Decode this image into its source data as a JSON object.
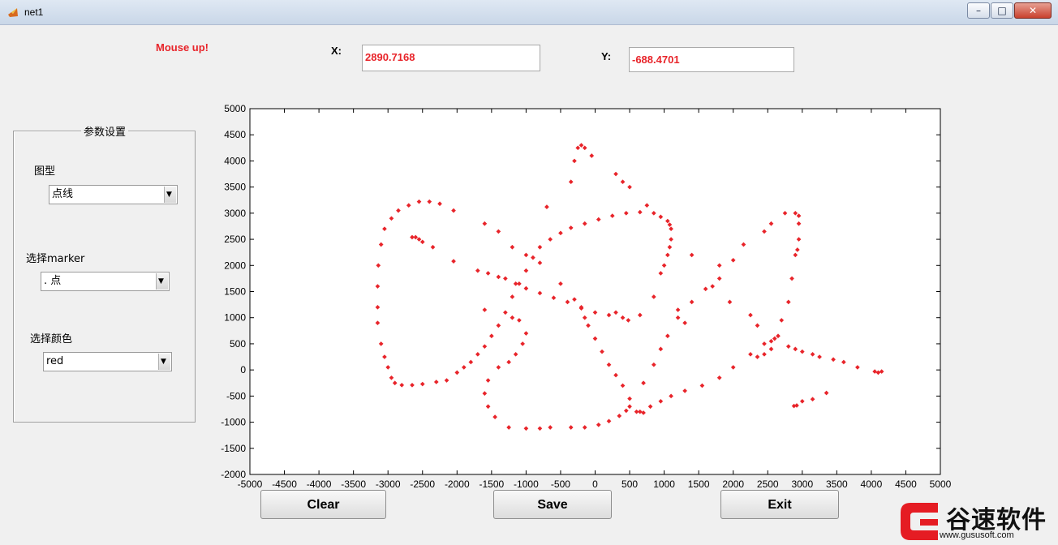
{
  "window": {
    "title": "net1"
  },
  "status": {
    "mouse": "Mouse up!"
  },
  "coords": {
    "x_label": "X:",
    "x_value": "2890.7168",
    "y_label": "Y:",
    "y_value": "-688.4701"
  },
  "panel": {
    "title": "参数设置",
    "plot_type": {
      "label": "图型",
      "value": "点线"
    },
    "marker": {
      "label": "选择marker",
      "value": ". 点"
    },
    "color": {
      "label": "选择颜色",
      "value": "red"
    }
  },
  "buttons": {
    "clear": "Clear",
    "save": "Save",
    "exit": "Exit"
  },
  "watermark": {
    "brand": "谷速软件",
    "url": "www.gususoft.com"
  },
  "colors": {
    "accent": "#e8242a",
    "marker": "#e8242a"
  },
  "chart_data": {
    "type": "scatter",
    "xlim": [
      -5000,
      5000
    ],
    "ylim": [
      -2000,
      5000
    ],
    "xticks": [
      "-5000",
      "-4500",
      "-4000",
      "-3500",
      "-3000",
      "-2500",
      "-2000",
      "-1500",
      "-1000",
      "-500",
      "0",
      "500",
      "1000",
      "1500",
      "2000",
      "2500",
      "3000",
      "3500",
      "4000",
      "4500",
      "5000"
    ],
    "yticks": [
      "-2000",
      "-1500",
      "-1000",
      "-500",
      "0",
      "500",
      "1000",
      "1500",
      "2000",
      "2500",
      "3000",
      "3500",
      "4000",
      "4500",
      "5000"
    ],
    "series": [
      {
        "color": "#e8242a",
        "points": [
          [
            -3150,
            900
          ],
          [
            -3150,
            1200
          ],
          [
            -3150,
            1600
          ],
          [
            -3140,
            2000
          ],
          [
            -3100,
            2400
          ],
          [
            -3050,
            2700
          ],
          [
            -2950,
            2900
          ],
          [
            -2850,
            3050
          ],
          [
            -2700,
            3150
          ],
          [
            -2550,
            3220
          ],
          [
            -2400,
            3220
          ],
          [
            -2250,
            3180
          ],
          [
            -2050,
            3050
          ],
          [
            -3100,
            500
          ],
          [
            -3050,
            250
          ],
          [
            -3000,
            50
          ],
          [
            -2950,
            -150
          ],
          [
            -2900,
            -250
          ],
          [
            -2800,
            -290
          ],
          [
            -2650,
            -290
          ],
          [
            -2500,
            -270
          ],
          [
            -2300,
            -230
          ],
          [
            -2150,
            -200
          ],
          [
            -2000,
            -50
          ],
          [
            -1900,
            50
          ],
          [
            -1800,
            150
          ],
          [
            -1700,
            300
          ],
          [
            -1600,
            450
          ],
          [
            -1500,
            650
          ],
          [
            -1400,
            850
          ],
          [
            -1300,
            1100
          ],
          [
            -1200,
            1400
          ],
          [
            -1100,
            1650
          ],
          [
            -1000,
            1900
          ],
          [
            -900,
            2150
          ],
          [
            -800,
            2350
          ],
          [
            -650,
            2500
          ],
          [
            -500,
            2620
          ],
          [
            -350,
            2720
          ],
          [
            -150,
            2800
          ],
          [
            50,
            2880
          ],
          [
            250,
            2950
          ],
          [
            450,
            3000
          ],
          [
            650,
            3020
          ],
          [
            850,
            3000
          ],
          [
            950,
            2930
          ],
          [
            1050,
            2850
          ],
          [
            1080,
            2780
          ],
          [
            1100,
            2700
          ],
          [
            1100,
            2500
          ],
          [
            1080,
            2350
          ],
          [
            1050,
            2200
          ],
          [
            1000,
            2000
          ],
          [
            950,
            1850
          ],
          [
            -2650,
            2540
          ],
          [
            -2600,
            2540
          ],
          [
            -2550,
            2500
          ],
          [
            -2500,
            2450
          ],
          [
            -2350,
            2350
          ],
          [
            -2050,
            2080
          ],
          [
            -1700,
            1900
          ],
          [
            -1550,
            1850
          ],
          [
            -1400,
            1780
          ],
          [
            -1300,
            1750
          ],
          [
            -1150,
            1650
          ],
          [
            -1000,
            1560
          ],
          [
            -800,
            1470
          ],
          [
            -600,
            1380
          ],
          [
            -400,
            1300
          ],
          [
            -200,
            1180
          ],
          [
            0,
            1100
          ],
          [
            200,
            1050
          ],
          [
            400,
            1000
          ],
          [
            480,
            950
          ],
          [
            -700,
            3120
          ],
          [
            -350,
            3600
          ],
          [
            -300,
            4000
          ],
          [
            -250,
            4250
          ],
          [
            -200,
            4300
          ],
          [
            -150,
            4250
          ],
          [
            -50,
            4100
          ],
          [
            300,
            3750
          ],
          [
            400,
            3600
          ],
          [
            500,
            3500
          ],
          [
            750,
            3150
          ],
          [
            -1600,
            2800
          ],
          [
            -1400,
            2650
          ],
          [
            -1200,
            2350
          ],
          [
            -1000,
            2200
          ],
          [
            -800,
            2050
          ],
          [
            -1600,
            1150
          ],
          [
            -1200,
            1000
          ],
          [
            -1100,
            950
          ],
          [
            -1000,
            700
          ],
          [
            -1050,
            500
          ],
          [
            -1150,
            300
          ],
          [
            -1250,
            150
          ],
          [
            -1400,
            50
          ],
          [
            -1550,
            -200
          ],
          [
            -1600,
            -450
          ],
          [
            -1550,
            -700
          ],
          [
            -1450,
            -900
          ],
          [
            -1250,
            -1100
          ],
          [
            -1000,
            -1120
          ],
          [
            -800,
            -1120
          ],
          [
            -650,
            -1100
          ],
          [
            -350,
            -1100
          ],
          [
            -150,
            -1100
          ],
          [
            50,
            -1050
          ],
          [
            200,
            -980
          ],
          [
            350,
            -880
          ],
          [
            450,
            -780
          ],
          [
            500,
            -700
          ],
          [
            -500,
            1650
          ],
          [
            -300,
            1350
          ],
          [
            -200,
            1200
          ],
          [
            -150,
            1000
          ],
          [
            -100,
            850
          ],
          [
            0,
            600
          ],
          [
            100,
            350
          ],
          [
            200,
            100
          ],
          [
            300,
            -100
          ],
          [
            400,
            -300
          ],
          [
            500,
            -550
          ],
          [
            600,
            -800
          ],
          [
            650,
            -800
          ],
          [
            700,
            -820
          ],
          [
            800,
            -700
          ],
          [
            950,
            -600
          ],
          [
            1100,
            -500
          ],
          [
            1300,
            -400
          ],
          [
            1550,
            -300
          ],
          [
            1800,
            -150
          ],
          [
            2000,
            50
          ],
          [
            2250,
            300
          ],
          [
            2450,
            500
          ],
          [
            2550,
            550
          ],
          [
            2650,
            650
          ],
          [
            700,
            -250
          ],
          [
            850,
            100
          ],
          [
            950,
            400
          ],
          [
            1050,
            650
          ],
          [
            1200,
            1000
          ],
          [
            1400,
            1300
          ],
          [
            1600,
            1550
          ],
          [
            1800,
            1750
          ],
          [
            2000,
            2100
          ],
          [
            2150,
            2400
          ],
          [
            2450,
            2650
          ],
          [
            2550,
            2800
          ],
          [
            2750,
            3000
          ],
          [
            2900,
            3000
          ],
          [
            2950,
            2950
          ],
          [
            2950,
            2800
          ],
          [
            2950,
            2500
          ],
          [
            2930,
            2300
          ],
          [
            2900,
            2200
          ],
          [
            2850,
            1750
          ],
          [
            2800,
            1300
          ],
          [
            2700,
            950
          ],
          [
            2600,
            600
          ],
          [
            2550,
            400
          ],
          [
            2450,
            300
          ],
          [
            2350,
            250
          ],
          [
            2800,
            450
          ],
          [
            2900,
            400
          ],
          [
            3000,
            350
          ],
          [
            3150,
            300
          ],
          [
            3250,
            250
          ],
          [
            3450,
            200
          ],
          [
            3600,
            150
          ],
          [
            3800,
            50
          ],
          [
            4050,
            -30
          ],
          [
            4100,
            -50
          ],
          [
            4150,
            -30
          ],
          [
            3350,
            -440
          ],
          [
            3150,
            -560
          ],
          [
            3000,
            -600
          ],
          [
            2920,
            -680
          ],
          [
            2880,
            -690
          ],
          [
            850,
            1400
          ],
          [
            1200,
            1150
          ],
          [
            1300,
            900
          ],
          [
            1700,
            1600
          ],
          [
            1950,
            1300
          ],
          [
            2250,
            1050
          ],
          [
            2350,
            850
          ],
          [
            1400,
            2200
          ],
          [
            1800,
            2000
          ],
          [
            650,
            1050
          ],
          [
            300,
            1100
          ]
        ]
      }
    ]
  }
}
